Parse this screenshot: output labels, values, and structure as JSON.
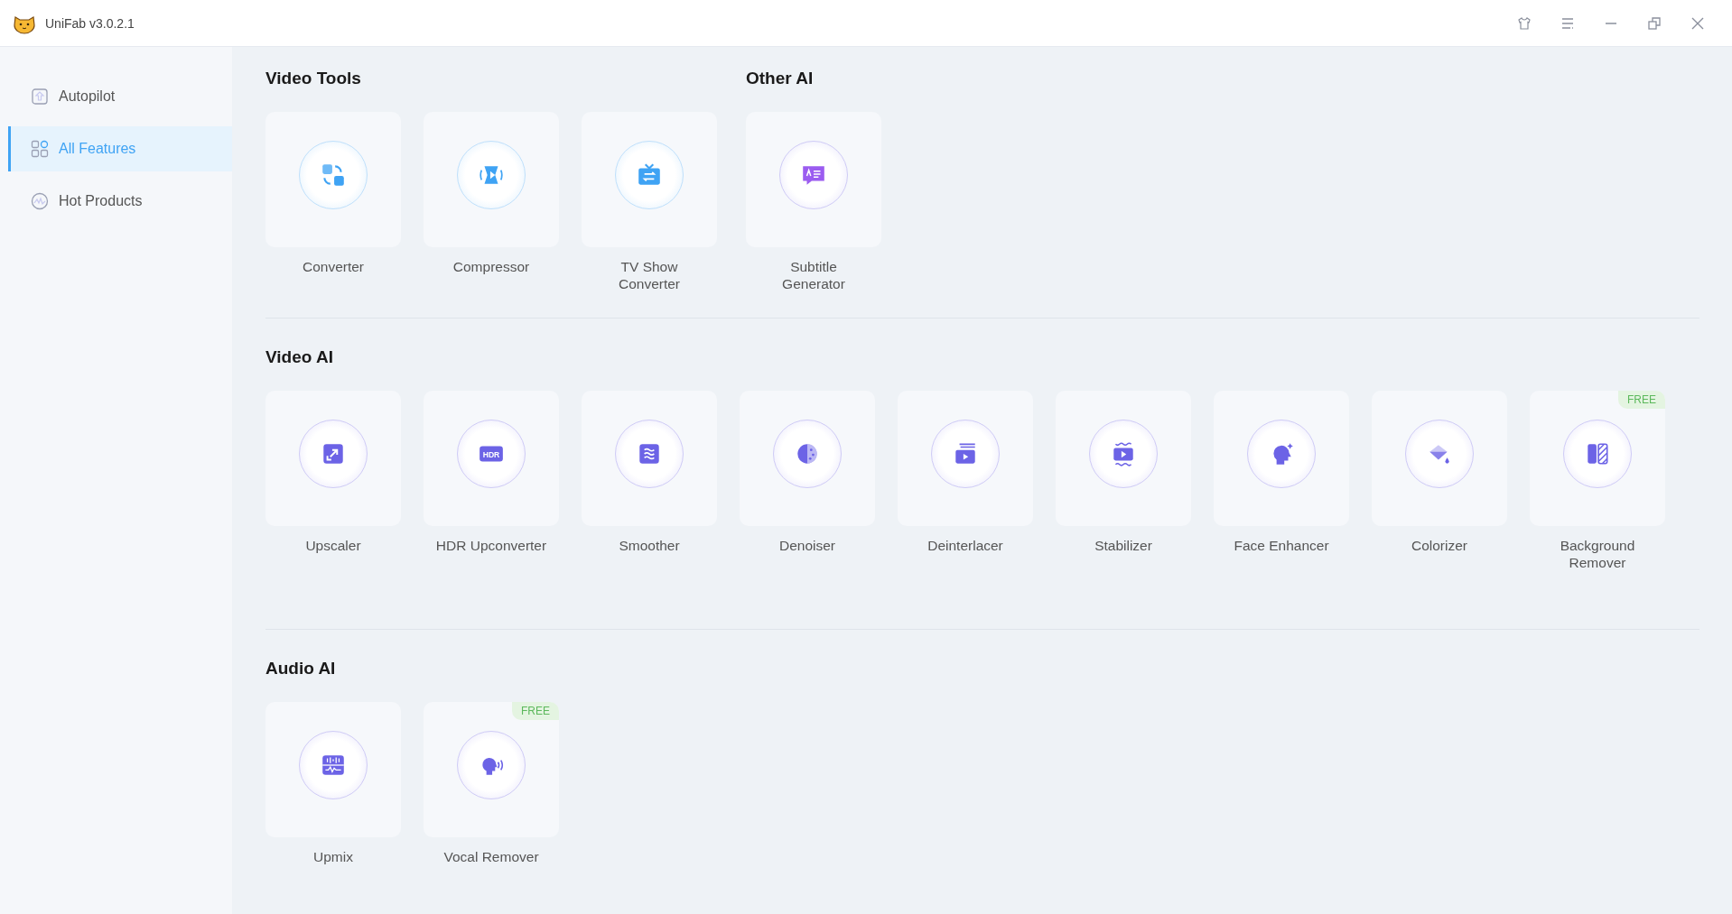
{
  "window": {
    "title": "UniFab v3.0.2.1"
  },
  "sidebar": {
    "items": [
      {
        "label": "Autopilot",
        "kind": "autopilot",
        "selected": false
      },
      {
        "label": "All Features",
        "kind": "features",
        "selected": true
      },
      {
        "label": "Hot Products",
        "kind": "hot",
        "selected": false
      }
    ]
  },
  "sections": [
    {
      "groups": [
        {
          "title": "Video Tools",
          "items": [
            {
              "label": "Converter",
              "kind": "converter"
            },
            {
              "label": "Compressor",
              "kind": "compressor"
            },
            {
              "label": "TV Show Converter",
              "kind": "tv"
            }
          ]
        },
        {
          "title": "Other AI",
          "items": [
            {
              "label": "Subtitle Generator",
              "kind": "subtitle"
            }
          ]
        }
      ]
    },
    {
      "groups": [
        {
          "title": "Video AI",
          "items": [
            {
              "label": "Upscaler",
              "kind": "upscaler"
            },
            {
              "label": "HDR Upconverter",
              "kind": "hdr",
              "icon_text": "HDR"
            },
            {
              "label": "Smoother",
              "kind": "smoother"
            },
            {
              "label": "Denoiser",
              "kind": "denoiser"
            },
            {
              "label": "Deinterlacer",
              "kind": "deinterlacer"
            },
            {
              "label": "Stabilizer",
              "kind": "stabilizer"
            },
            {
              "label": "Face Enhancer",
              "kind": "face"
            },
            {
              "label": "Colorizer",
              "kind": "colorizer"
            },
            {
              "label": "Background Remover",
              "kind": "bgremover",
              "badge": "FREE"
            }
          ]
        }
      ]
    },
    {
      "groups": [
        {
          "title": "Audio AI",
          "items": [
            {
              "label": "Upmix",
              "kind": "upmix"
            },
            {
              "label": "Vocal Remover",
              "kind": "vocal",
              "badge": "FREE"
            }
          ]
        }
      ]
    }
  ]
}
